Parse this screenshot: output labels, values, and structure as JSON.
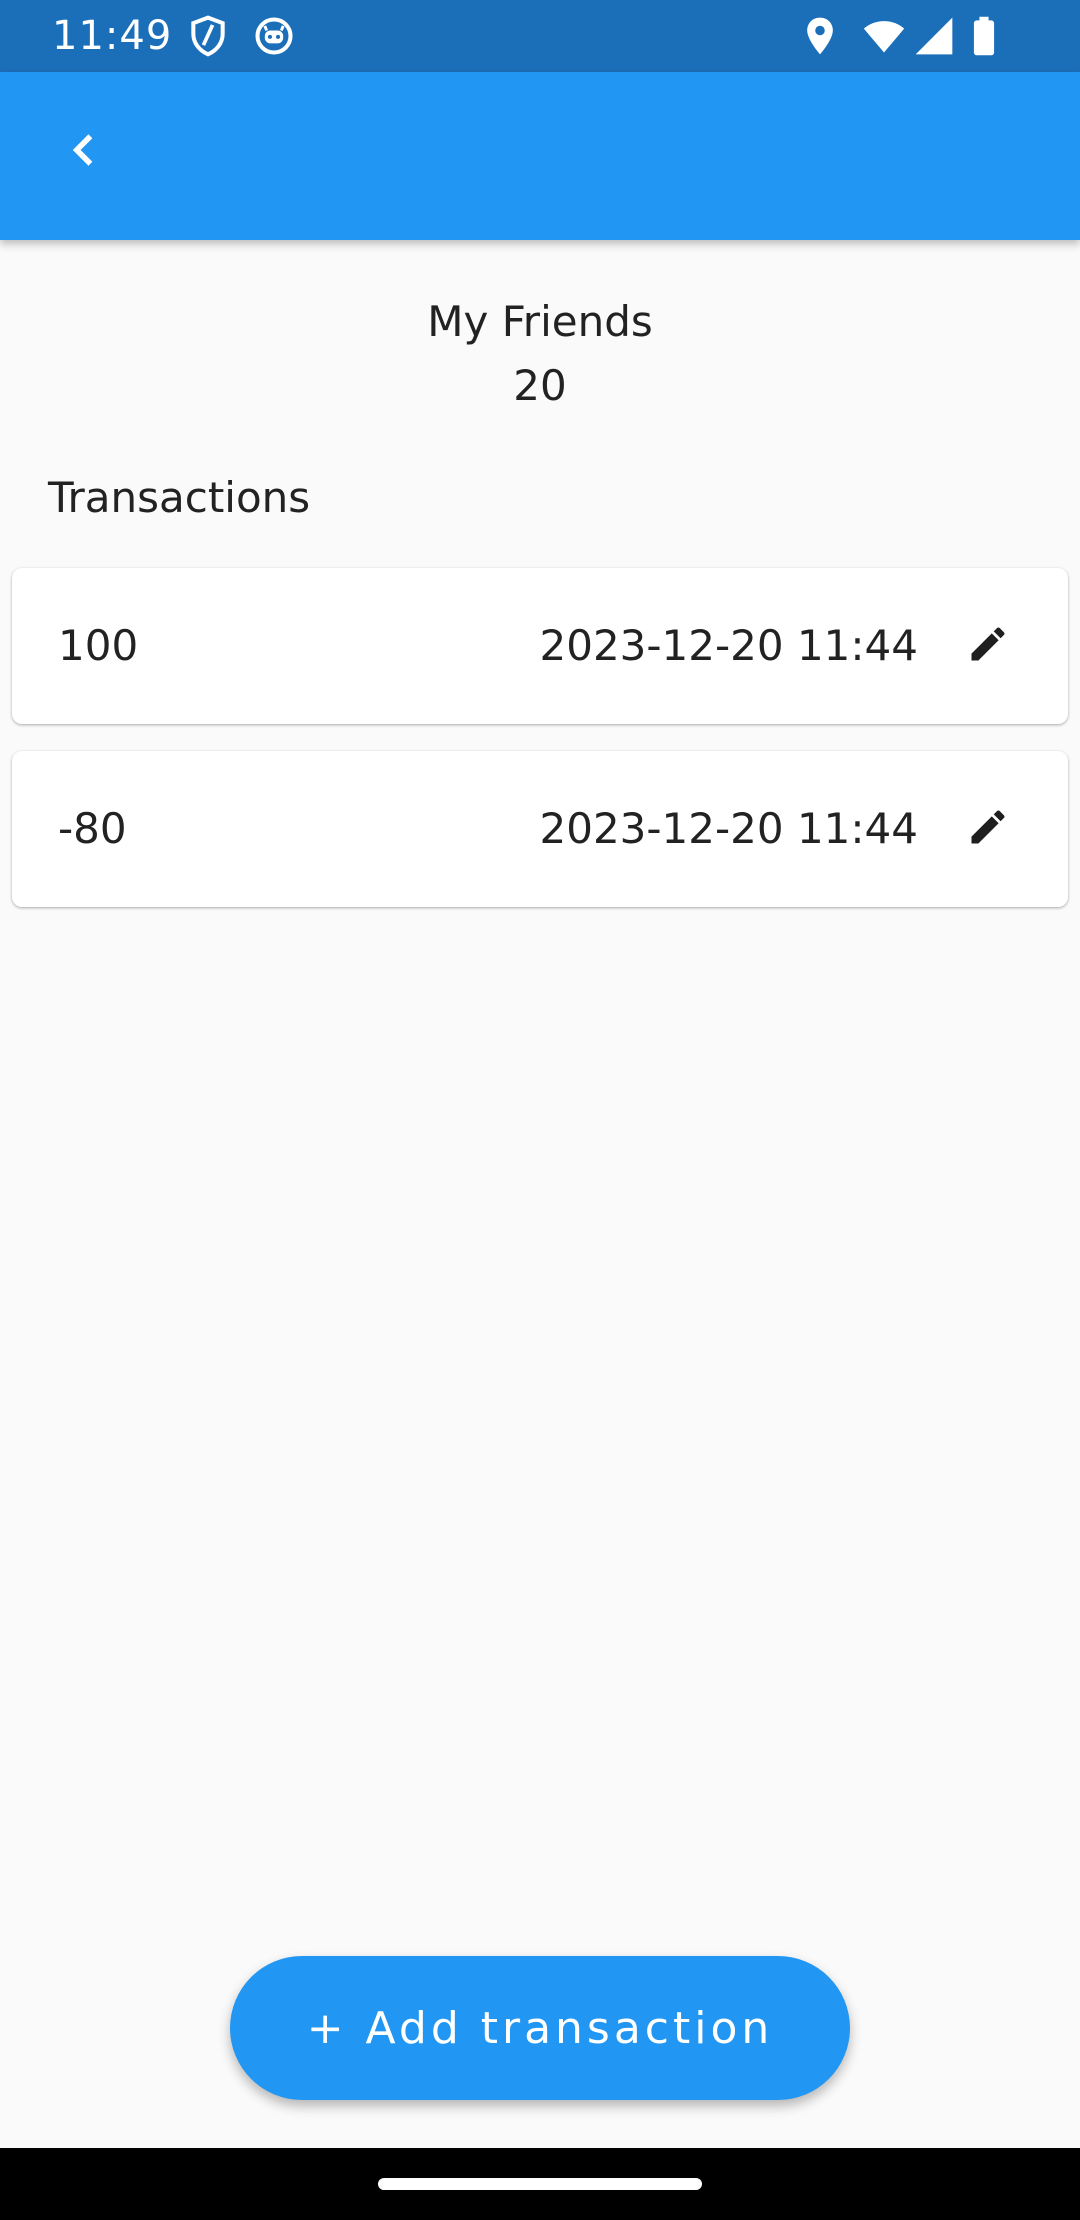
{
  "status_bar": {
    "time": "11:49",
    "icons_left": [
      "shield-icon",
      "notification-bot-icon"
    ],
    "icons_right": [
      "location-icon",
      "wifi-icon",
      "signal-icon",
      "battery-icon"
    ],
    "background": "#1b6fb9"
  },
  "app_bar": {
    "background": "#2196f3",
    "back_icon": "chevron-left-icon"
  },
  "header": {
    "friend_name": "My Friends",
    "balance": "20"
  },
  "transactions": {
    "title": "Transactions",
    "items": [
      {
        "amount": "100",
        "date": "2023-12-20 11:44",
        "edit_icon": "pencil-icon"
      },
      {
        "amount": "-80",
        "date": "2023-12-20 11:44",
        "edit_icon": "pencil-icon"
      }
    ]
  },
  "fab": {
    "label": "+ Add transaction",
    "background": "#2196f3"
  }
}
